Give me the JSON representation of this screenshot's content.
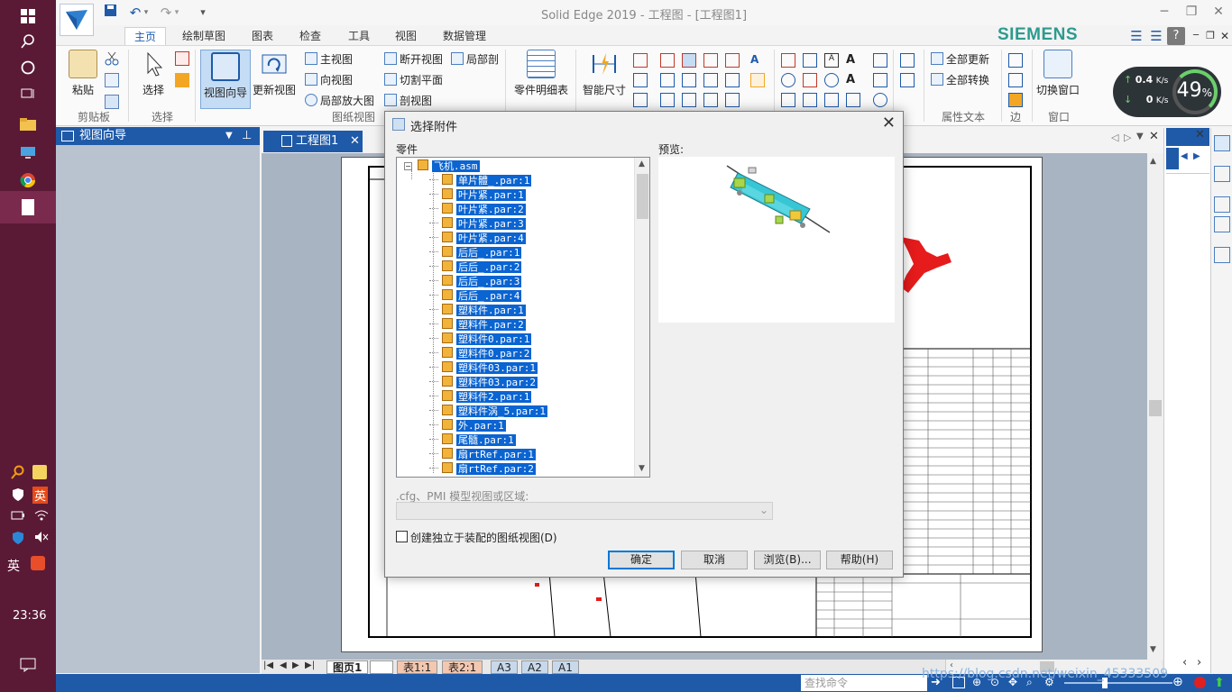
{
  "taskbar": {
    "clock": "23:36",
    "ime_label": "英",
    "ime_label2": "英"
  },
  "window": {
    "title": "Solid Edge 2019 - 工程图 - [工程图1]",
    "brand": "SIEMENS"
  },
  "ribbon": {
    "tabs": [
      "主页",
      "绘制草图",
      "图表",
      "检查",
      "工具",
      "视图",
      "数据管理"
    ],
    "active_tab": "主页",
    "paste": "粘贴",
    "select": "选择",
    "view_wizard": "视图向导",
    "update_views": "更新视图",
    "main_view": "主视图",
    "projected_view": "向视图",
    "detail_view": "局部放大图",
    "broken_view": "断开视图",
    "cutting_plane": "切割平面",
    "section_view": "剖视图",
    "partial_section": "局部剖",
    "parts_list": "零件明细表",
    "smart_dimension": "智能尺寸",
    "update_all": "全部更新",
    "convert_all": "全部转换",
    "switch_window": "切换窗口",
    "groups": {
      "clipboard": "剪贴板",
      "select": "选择",
      "drawing_views": "图纸视图",
      "property_text": "属性文本",
      "edge": "边",
      "window": "窗口"
    }
  },
  "perf": {
    "up_rate": "0.4",
    "up_unit": "K/s",
    "down_rate": "0",
    "down_unit": "K/s",
    "cpu_pct": "49",
    "cpu_suffix": "%"
  },
  "left_pane": {
    "title": "视图向导"
  },
  "document": {
    "tab_label": "工程图1"
  },
  "sheet_tabs": [
    "图页1",
    "表1:1",
    "表2:1",
    "A3",
    "A2",
    "A1"
  ],
  "status": {
    "command_finder_placeholder": "查找命令"
  },
  "watermark": "https://blog.csdn.net/weixin_45333509",
  "dialog": {
    "title": "选择附件",
    "parts_label": "零件",
    "preview_label": "预览:",
    "root": "飞机.asm",
    "parts": [
      "单片體_.par:1",
      "叶片紧.par:1",
      "叶片紧.par:2",
      "叶片紧.par:3",
      "叶片紧.par:4",
      "后后_.par:1",
      "后后_.par:2",
      "后后_.par:3",
      "后后_.par:4",
      "塑料件.par:1",
      "塑料件.par:2",
      "塑料件0.par:1",
      "塑料件0.par:2",
      "塑料件03.par:1",
      "塑料件03.par:2",
      "塑料件2.par:1",
      "塑料件涡_5.par:1",
      "外.par:1",
      "尾髓.par:1",
      "扇rtRef.par:1",
      "扇rtRef.par:2"
    ],
    "cfg_label": ".cfg、PMI 模型视图或区域:",
    "cfg_value": "",
    "checkbox_label": "创建独立于装配的图纸视图(D)",
    "checkbox_checked": false,
    "ok": "确定",
    "cancel": "取消",
    "browse": "浏览(B)...",
    "help": "帮助(H)"
  }
}
